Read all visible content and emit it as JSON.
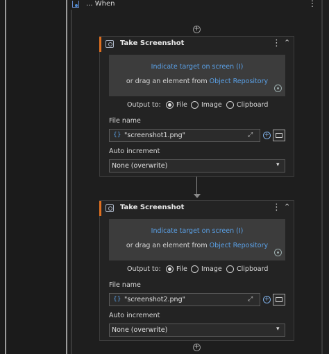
{
  "when": {
    "label": "... When",
    "menu": "⋮"
  },
  "activities": [
    {
      "title": "Take Screenshot",
      "menu": "⋮",
      "collapse": "⌃",
      "indicate_link": "Indicate target on screen (I)",
      "drag_prefix": "or drag an element from ",
      "drag_link": "Object Repository",
      "output_label": "Output to:",
      "options": [
        "File",
        "Image",
        "Clipboard"
      ],
      "selected_option": "File",
      "file_name_label": "File name",
      "braces": "{}",
      "file_name_value": "\"screenshot1.png\"",
      "auto_increment_label": "Auto increment",
      "auto_increment_value": "None (overwrite)"
    },
    {
      "title": "Take Screenshot",
      "menu": "⋮",
      "collapse": "⌃",
      "indicate_link": "Indicate target on screen (I)",
      "drag_prefix": "or drag an element from ",
      "drag_link": "Object Repository",
      "output_label": "Output to:",
      "options": [
        "File",
        "Image",
        "Clipboard"
      ],
      "selected_option": "File",
      "file_name_label": "File name",
      "braces": "{}",
      "file_name_value": "\"screenshot2.png\"",
      "auto_increment_label": "Auto increment",
      "auto_increment_value": "None (overwrite)"
    }
  ],
  "add_symbol": "+",
  "colors": {
    "accent": "#e07020",
    "link": "#5aa0e6",
    "background": "#1e1e1e"
  }
}
